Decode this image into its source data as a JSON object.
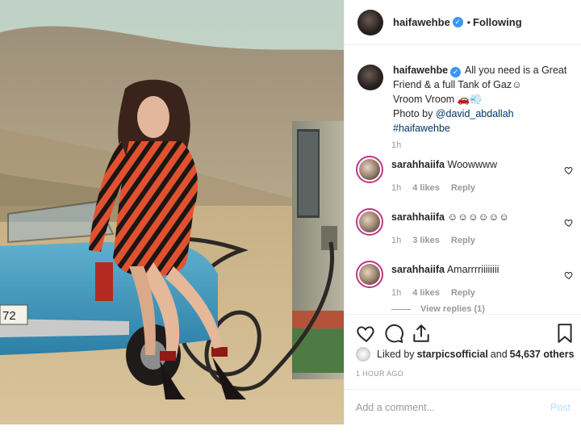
{
  "post": {
    "header": {
      "username": "haifawehbe",
      "separator": "•",
      "follow_status": "Following"
    },
    "caption": {
      "username": "haifawehbe",
      "text_line1": "All you need is a Great Friend & a full Tank of Gaz",
      "emoji1": "☺",
      "text_line2": "Vroom Vroom ",
      "emoji2": "🚗💨",
      "photo_by_prefix": "Photo by ",
      "photo_by_handle": "@david_abdallah",
      "hashtag": "#haifawehbe",
      "time": "1h"
    },
    "comments": [
      {
        "username": "sarahhaiifa",
        "text": "Woowwww",
        "time": "1h",
        "likes": "4 likes",
        "reply": "Reply"
      },
      {
        "username": "sarahhaiifa",
        "text": "☺☺☺☺☺☺",
        "time": "1h",
        "likes": "3 likes",
        "reply": "Reply"
      },
      {
        "username": "sarahhaiifa",
        "text": "Amarrrriiiiiiii",
        "time": "1h",
        "likes": "4 likes",
        "reply": "Reply"
      }
    ],
    "view_replies": "View replies (1)",
    "likes": {
      "prefix": "Liked by ",
      "user": "starpicsofficial",
      "middle": " and ",
      "count": "54,637 others"
    },
    "ago": "1 HOUR AGO",
    "add_comment": {
      "placeholder": "Add a comment...",
      "post_label": "Post"
    },
    "photo": {
      "car_plate": "72 "
    }
  },
  "colors": {
    "accent": "#3897f0",
    "link": "#003569",
    "story_ring": "#c13584",
    "muted": "#999999"
  },
  "icons": [
    "heart-icon",
    "comment-icon",
    "share-icon",
    "bookmark-icon",
    "verified-badge-icon"
  ]
}
